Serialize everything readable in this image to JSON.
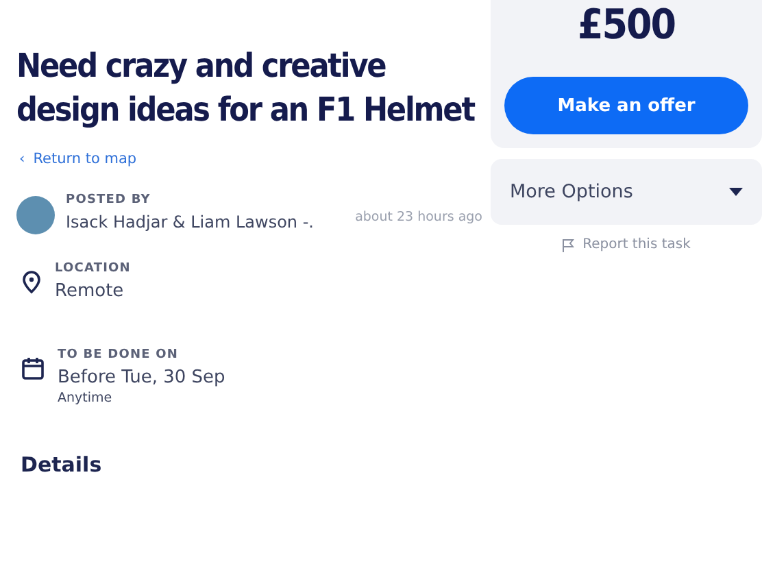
{
  "title": "Need crazy and creative\ndesign ideas for an F1 Helmet",
  "back_link": {
    "arrow": "‹",
    "label": "Return to map"
  },
  "posted_by": {
    "label": "POSTED BY",
    "name": "Isack Hadjar & Liam Lawson -.",
    "time": "about 23 hours ago"
  },
  "info": [
    {
      "kind": "location",
      "label": "LOCATION",
      "value": "Remote"
    },
    {
      "kind": "date",
      "label": "TO BE DONE ON",
      "value": "Before Tue, 30 Sep",
      "note": "Anytime"
    }
  ],
  "details": {
    "heading": "Details"
  },
  "offer_card": {
    "price": "£500",
    "button": "Make an offer"
  },
  "more_options": {
    "label": "More Options",
    "expanded": false
  },
  "report": {
    "label": "Report this task"
  }
}
